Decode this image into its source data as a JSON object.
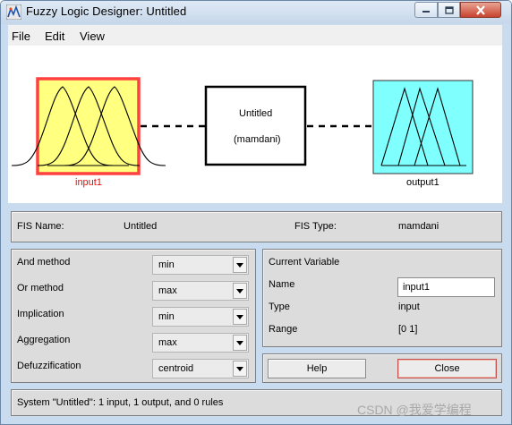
{
  "window": {
    "title": "Fuzzy Logic Designer: Untitled",
    "controls": {
      "minimize_icon": "minimize-icon",
      "maximize_icon": "maximize-icon",
      "close_icon": "close-icon"
    }
  },
  "menu": {
    "items": [
      "File",
      "Edit",
      "View"
    ]
  },
  "diagram": {
    "input_label": "input1",
    "system_name": "Untitled",
    "system_type": "(mamdani)",
    "output_label": "output1",
    "colors": {
      "input_fill": "#ffff80",
      "input_border": "#ff4040",
      "input_label": "#ff0000",
      "output_fill": "#80ffff"
    }
  },
  "fis": {
    "name_label": "FIS Name:",
    "name_value": "Untitled",
    "type_label": "FIS Type:",
    "type_value": "mamdani"
  },
  "methods": [
    {
      "label": "And method",
      "value": "min"
    },
    {
      "label": "Or method",
      "value": "max"
    },
    {
      "label": "Implication",
      "value": "min"
    },
    {
      "label": "Aggregation",
      "value": "max"
    },
    {
      "label": "Defuzzification",
      "value": "centroid"
    }
  ],
  "current_variable": {
    "title": "Current Variable",
    "name_label": "Name",
    "name_value": "input1",
    "type_label": "Type",
    "type_value": "input",
    "range_label": "Range",
    "range_value": "[0 1]"
  },
  "buttons": {
    "help": "Help",
    "close": "Close"
  },
  "status": "System \"Untitled\": 1 input, 1 output, and 0 rules",
  "watermark": "CSDN @我爱学编程"
}
